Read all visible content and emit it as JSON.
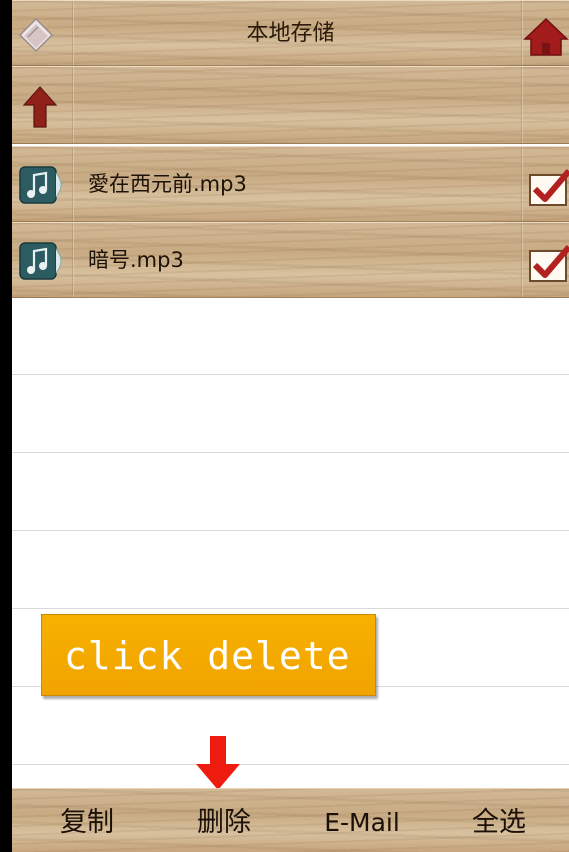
{
  "header": {
    "title": "本地存储",
    "left_icon": "storage-device-icon",
    "right_icon": "home-icon"
  },
  "nav": {
    "up_icon": "up-arrow-icon"
  },
  "files": [
    {
      "name": "愛在西元前.mp3",
      "icon": "music-file-icon",
      "checked": true
    },
    {
      "name": "暗号.mp3",
      "icon": "music-file-icon",
      "checked": true
    }
  ],
  "instruction": {
    "text": "click delete"
  },
  "toolbar": {
    "copy_label": "复制",
    "delete_label": "删除",
    "email_label": "E-Mail",
    "select_all_label": "全选"
  },
  "colors": {
    "wood": "#c8ab84",
    "instruction_bg": "#f5ad00",
    "arrow_red": "#ee1c0e",
    "check_red": "#b32020",
    "home_red": "#a31c1c"
  }
}
